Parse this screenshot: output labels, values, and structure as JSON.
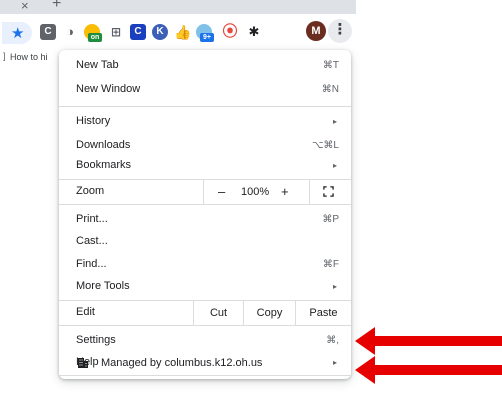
{
  "tabstrip": {
    "close_glyph": "×",
    "new_tab_glyph": "+"
  },
  "toolbar": {
    "star_icon": "star-icon",
    "extensions": [
      {
        "name": "extension-c-icon",
        "glyph": "C"
      },
      {
        "name": "extension-circle-icon",
        "glyph": "◑"
      },
      {
        "name": "extension-on-icon",
        "glyph": "",
        "badge": "on"
      },
      {
        "name": "extension-grid-icon",
        "glyph": "⊞"
      },
      {
        "name": "extension-c-blue-icon",
        "glyph": "C"
      },
      {
        "name": "extension-k-icon",
        "glyph": "K"
      },
      {
        "name": "extension-hand-icon",
        "glyph": "👍"
      },
      {
        "name": "extension-badge-icon",
        "glyph": "",
        "badge": "9+"
      },
      {
        "name": "extension-record-icon",
        "glyph": "⦿"
      },
      {
        "name": "extensions-puzzle-icon",
        "glyph": "✱"
      }
    ],
    "avatar_letter": "M",
    "kebab_glyph": "⋮"
  },
  "bookmarks": {
    "first_label": "How to hi"
  },
  "menu": {
    "new_tab": {
      "label": "New Tab",
      "shortcut": "⌘T"
    },
    "new_window": {
      "label": "New Window",
      "shortcut": "⌘N"
    },
    "history": {
      "label": "History"
    },
    "downloads": {
      "label": "Downloads",
      "shortcut": "⌥⌘L"
    },
    "bookmarks": {
      "label": "Bookmarks"
    },
    "zoom": {
      "label": "Zoom",
      "minus": "–",
      "value": "100%",
      "plus": "+"
    },
    "print": {
      "label": "Print...",
      "shortcut": "⌘P"
    },
    "cast": {
      "label": "Cast..."
    },
    "find": {
      "label": "Find...",
      "shortcut": "⌘F"
    },
    "more_tools": {
      "label": "More Tools"
    },
    "edit": {
      "label": "Edit",
      "cut": "Cut",
      "copy": "Copy",
      "paste": "Paste"
    },
    "settings": {
      "label": "Settings",
      "shortcut": "⌘,"
    },
    "help": {
      "label": "Help"
    },
    "managed": {
      "label": "Managed by columbus.k12.oh.us"
    },
    "submenu_arrow": "▸"
  },
  "colors": {
    "annotation_arrow": "#e60000",
    "accent": "#1a73e8"
  }
}
